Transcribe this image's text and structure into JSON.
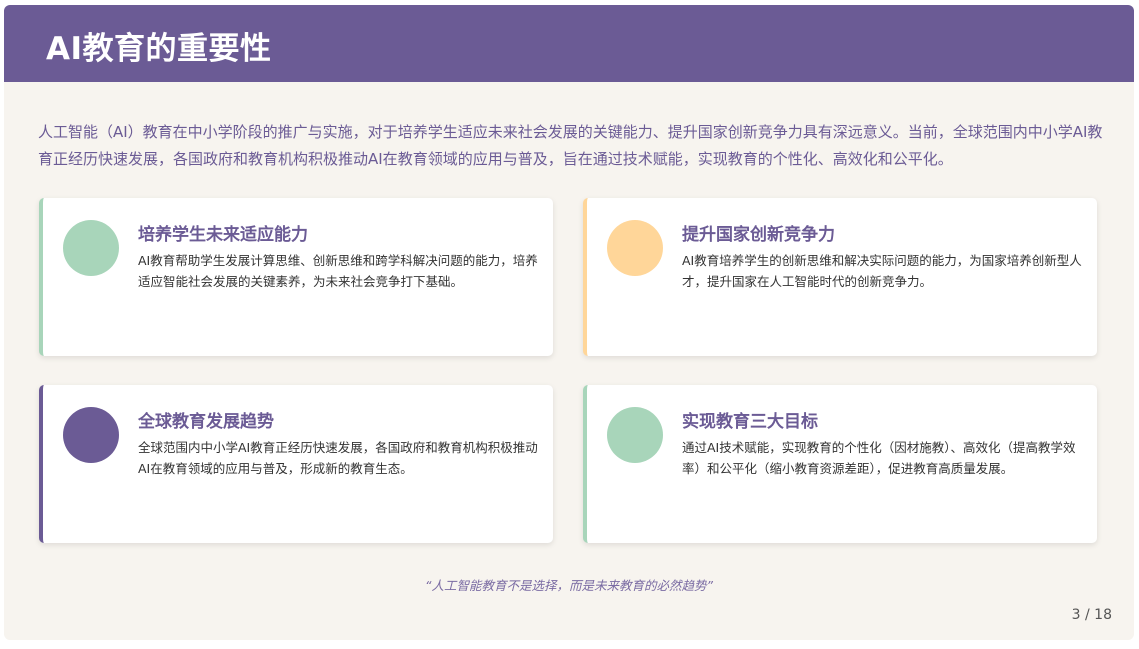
{
  "header": {
    "title": "AI教育的重要性"
  },
  "intro": "人工智能（AI）教育在中小学阶段的推广与实施，对于培养学生适应未来社会发展的关键能力、提升国家创新竞争力具有深远意义。当前，全球范围内中小学AI教育正经历快速发展，各国政府和教育机构积极推动AI在教育领域的应用与普及，旨在通过技术赋能，实现教育的个性化、高效化和公平化。",
  "cards": [
    {
      "title": "培养学生未来适应能力",
      "text": "AI教育帮助学生发展计算思维、创新思维和跨学科解决问题的能力，培养适应智能社会发展的关键素养，为未来社会竞争打下基础。",
      "accent": "#a8d5ba"
    },
    {
      "title": "提升国家创新竞争力",
      "text": "AI教育培养学生的创新思维和解决实际问题的能力，为国家培养创新型人才，提升国家在人工智能时代的创新竞争力。",
      "accent": "#ffd699"
    },
    {
      "title": "全球教育发展趋势",
      "text": "全球范围内中小学AI教育正经历快速发展，各国政府和教育机构积极推动AI在教育领域的应用与普及，形成新的教育生态。",
      "accent": "#6b5b95"
    },
    {
      "title": "实现教育三大目标",
      "text": "通过AI技术赋能，实现教育的个性化（因材施教）、高效化（提高教学效率）和公平化（缩小教育资源差距），促进教育高质量发展。",
      "accent": "#a8d5ba"
    }
  ],
  "quote": "“人工智能教育不是选择，而是未来教育的必然趋势”",
  "page_number": "3 / 18",
  "colors": {
    "header_bg": "#6b5b95",
    "slide_bg": "#f7f4ef",
    "title_purple": "#6b5b95",
    "mint": "#a8d5ba",
    "peach": "#ffd699"
  }
}
